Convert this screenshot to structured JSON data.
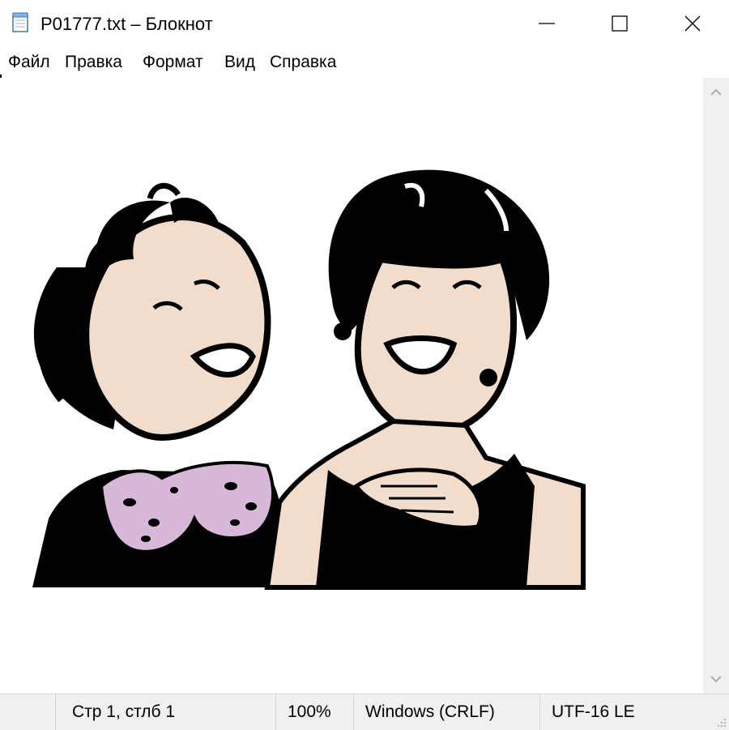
{
  "window": {
    "title": "P01777.txt – Блокнот",
    "icons": [
      "notepad-icon",
      "minimize-icon",
      "maximize-icon",
      "close-icon"
    ]
  },
  "menu": {
    "items": [
      "Файл",
      "Правка",
      "Формат",
      "Вид",
      "Справка"
    ]
  },
  "content": {
    "text": "",
    "image": "two-laughing-women-clipart",
    "colors": {
      "skin": "#f2dccb",
      "hair": "#000000",
      "collar": "#d7b8d8"
    }
  },
  "status": {
    "position": "Стр 1, стлб 1",
    "zoom": "100%",
    "line_ending": "Windows (CRLF)",
    "encoding": "UTF-16 LE"
  }
}
